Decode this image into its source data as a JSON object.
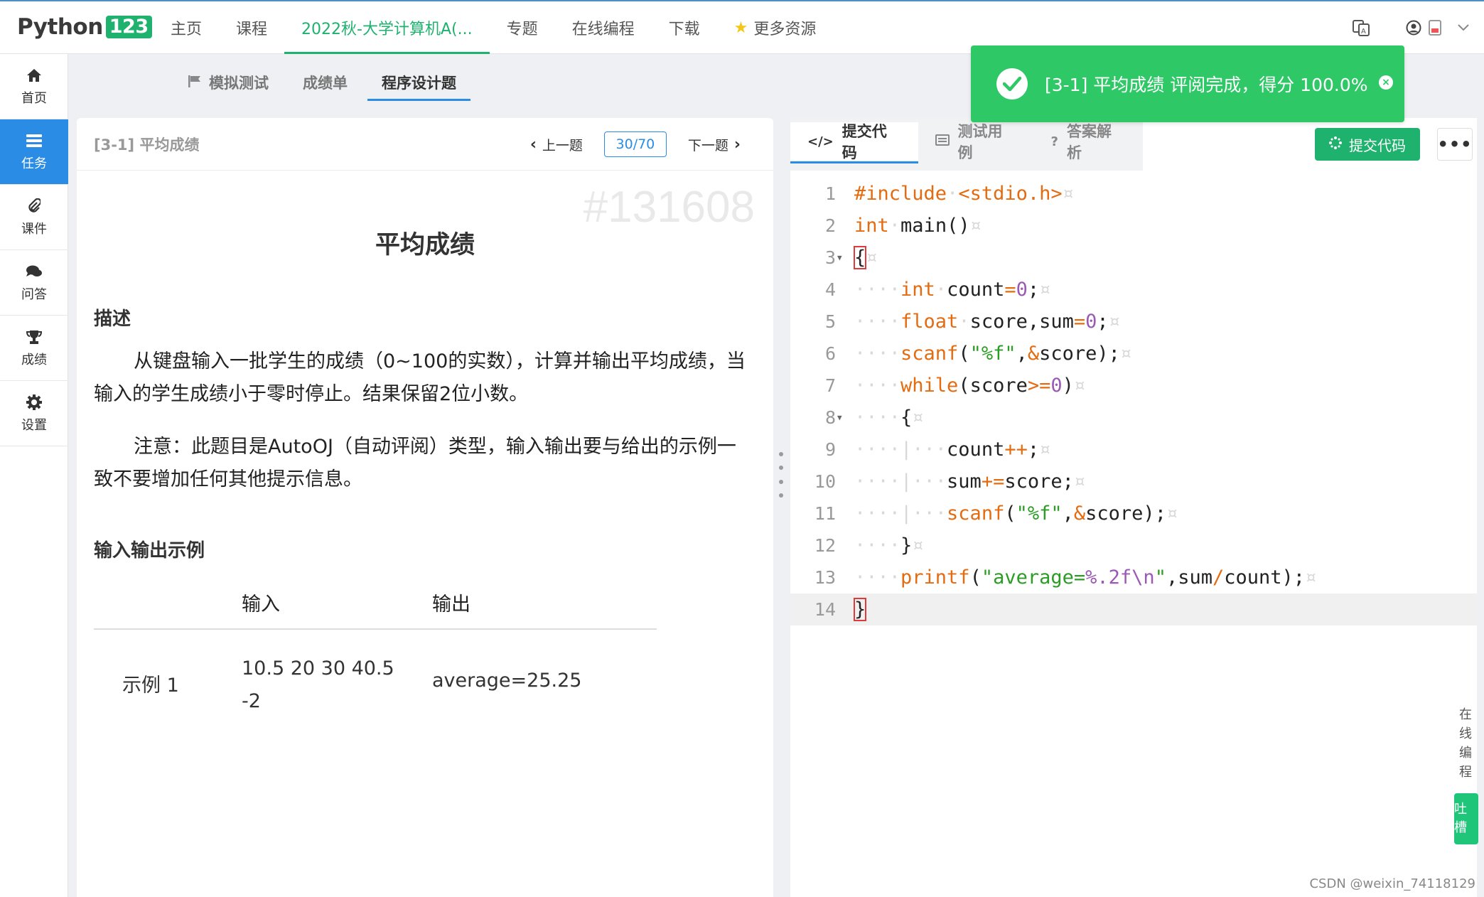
{
  "brand": {
    "name": "Python",
    "num": "123"
  },
  "nav": [
    {
      "label": "主页",
      "active": false
    },
    {
      "label": "课程",
      "active": false
    },
    {
      "label": "2022秋-大学计算机A(...",
      "active": true
    },
    {
      "label": "专题",
      "active": false
    },
    {
      "label": "在线编程",
      "active": false
    },
    {
      "label": "下载",
      "active": false
    },
    {
      "label": "更多资源",
      "active": false
    }
  ],
  "sidebar": [
    {
      "label": "首页",
      "icon": "home-icon"
    },
    {
      "label": "任务",
      "icon": "tasks-icon"
    },
    {
      "label": "课件",
      "icon": "paperclip-icon"
    },
    {
      "label": "问答",
      "icon": "comments-icon"
    },
    {
      "label": "成绩",
      "icon": "trophy-icon"
    },
    {
      "label": "设置",
      "icon": "gear-icon"
    }
  ],
  "subtabs": [
    "模拟测试",
    "成绩单",
    "程序设计题"
  ],
  "problem": {
    "header": "[3-1] 平均成绩",
    "prev": "上一题",
    "next": "下一题",
    "counter": "30/70",
    "watermark": "#131608",
    "title": "平均成绩",
    "desc_title": "描述",
    "desc1": "从键盘输入一批学生的成绩（0~100的实数），计算并输出平均成绩，当输入的学生成绩小于零时停止。结果保留2位小数。",
    "desc2": "注意：此题目是AutoOJ（自动评阅）类型，输入输出要与给出的示例一致不要增加任何其他提示信息。",
    "io_title": "输入输出示例",
    "io_head_in": "输入",
    "io_head_out": "输出",
    "example_label": "示例 1",
    "example_in": "10.5 20 30 40.5 -2",
    "example_out": "average=25.25"
  },
  "editor_tabs": [
    "提交代码",
    "测试用例",
    "答案解析"
  ],
  "submit_label": "提交代码",
  "more_label": "•••",
  "code_lines": [
    "1",
    "2",
    "3",
    "4",
    "5",
    "6",
    "7",
    "8",
    "9",
    "10",
    "11",
    "12",
    "13",
    "14"
  ],
  "toast": {
    "message": "[3-1] 平均成绩 评阅完成，得分 100.0%"
  },
  "right_side": {
    "online": "在线编程",
    "roast": "吐槽"
  },
  "credit": "CSDN @weixin_74118129",
  "colors": {
    "accent_green": "#1fb26f",
    "accent_blue": "#2b8ce6",
    "toast_green": "#2ec866"
  }
}
